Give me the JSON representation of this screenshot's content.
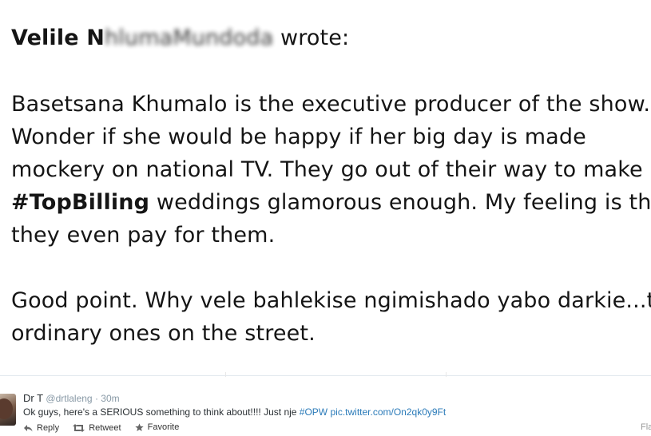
{
  "quote_image": {
    "author_visible": "Velile N",
    "author_obscured": "hlumaMundo",
    "author_tail": "da",
    "wrote": " wrote:",
    "line1": "Basetsana Khumalo is the executive producer of the show.",
    "line2": "Wonder if she would be happy if her big day is made",
    "line3": "mockery on national TV. They go out of their way to make",
    "line4_hashtag": "#TopBilling",
    "line4_rest": " weddings glamorous enough. My feeling is that",
    "line5": "they even pay for them.",
    "line6": "Good point. Why vele bahlekise ngimishado yabo darkie...the",
    "line7": "ordinary ones on the street."
  },
  "tweet": {
    "display_name": "Dr T",
    "username": "@drtlaleng",
    "separator": " · ",
    "time": "30m",
    "text": "Ok guys, here's a SERIOUS something to think about!!!! Just nje ",
    "hashtag": "#OPW",
    "link": "pic.twitter.com/On2qk0y9Ft",
    "actions": {
      "reply": "Reply",
      "retweet": "Retweet",
      "favorite": "Favorite"
    },
    "flag_partial": "Fla"
  },
  "icons": {
    "reply": "reply-icon",
    "retweet": "retweet-icon",
    "favorite": "star-icon"
  },
  "colors": {
    "link": "#2b7bb9",
    "muted": "#8899a6",
    "text": "#292f33"
  }
}
